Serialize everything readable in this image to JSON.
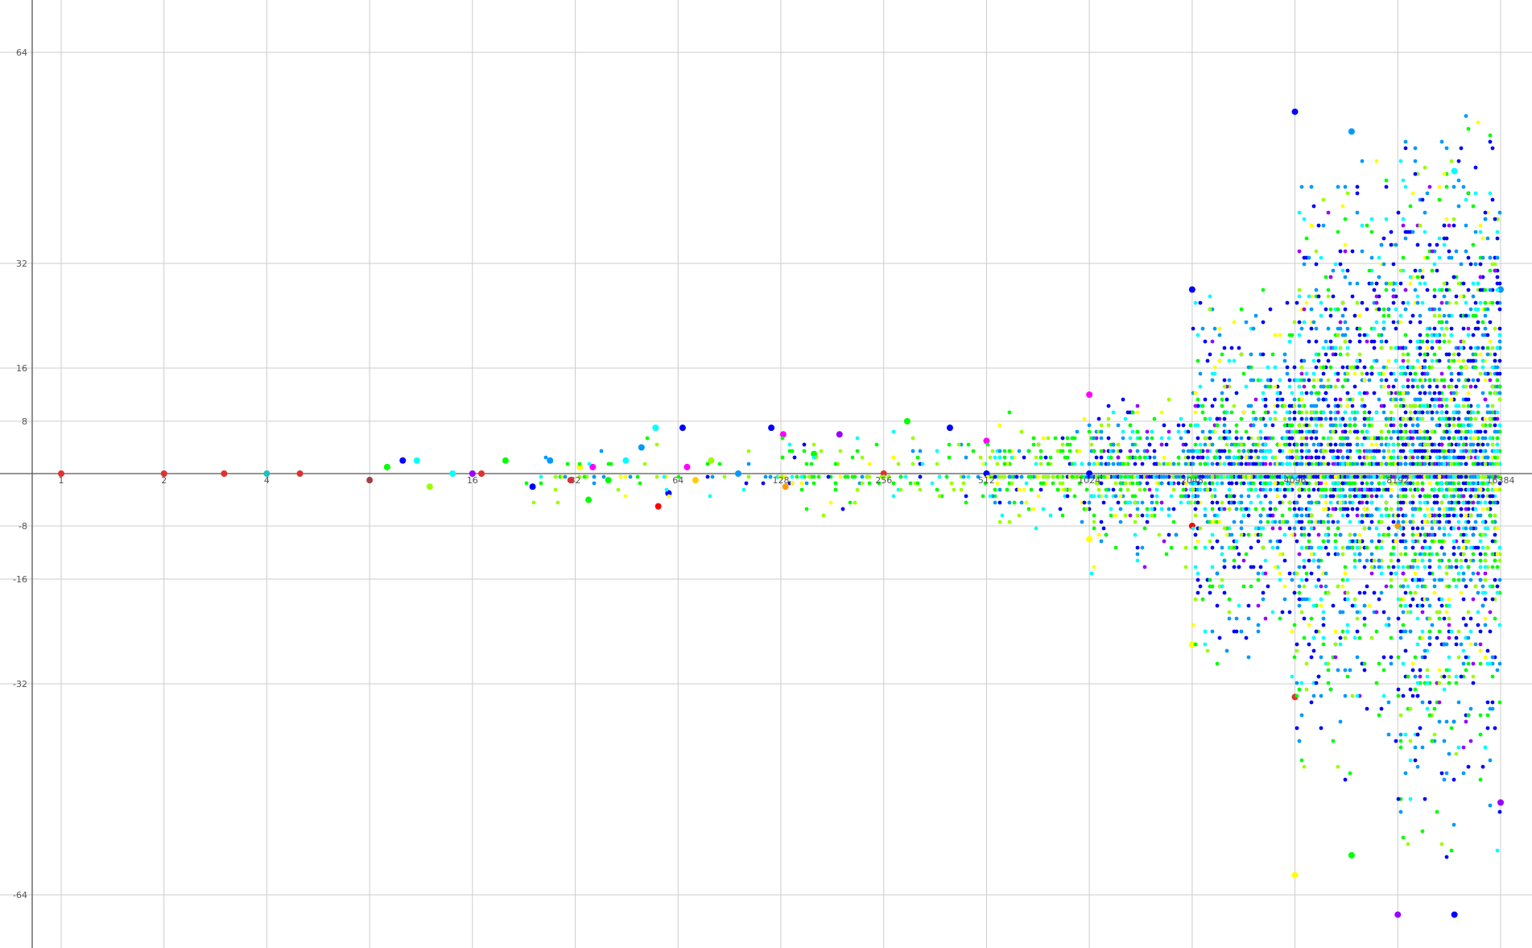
{
  "chart_data": {
    "type": "scatter",
    "title": "",
    "xlabel": "",
    "ylabel": "",
    "x_scale": "log2",
    "y_scale": "symlog2",
    "xlim": [
      0.75,
      17000
    ],
    "ylim": [
      -90,
      120
    ],
    "grid": true,
    "legend": "none",
    "x_ticks": [
      1,
      2,
      4,
      8,
      16,
      32,
      64,
      128,
      256,
      512,
      1024,
      2048,
      4096,
      8192,
      16384
    ],
    "x_tick_labels": [
      "1",
      "2",
      "4",
      "8",
      "16",
      "32",
      "64",
      "128",
      "256",
      "512",
      "1024",
      "2048",
      "4096",
      "8192",
      "16384"
    ],
    "y_ticks": [
      64,
      32,
      16,
      8,
      -8,
      -16,
      -32,
      -64
    ],
    "y_tick_labels": [
      "64",
      "32",
      "16",
      "8",
      "-8",
      "-16",
      "-32",
      "-64"
    ],
    "palette": [
      "#ff0000",
      "#ff9900",
      "#ffff00",
      "#99ff00",
      "#00ff00",
      "#00ffaa",
      "#00ffff",
      "#0099ff",
      "#0000ff",
      "#9900ff",
      "#ff00ff"
    ],
    "points": [
      {
        "x": 1,
        "y": 0,
        "c": "#e03030"
      },
      {
        "x": 2,
        "y": 0,
        "c": "#e03030"
      },
      {
        "x": 3,
        "y": 0,
        "c": "#e03030"
      },
      {
        "x": 4,
        "y": 0,
        "c": "#20c0c0"
      },
      {
        "x": 5,
        "y": 0,
        "c": "#e03030"
      },
      {
        "x": 8,
        "y": -1,
        "c": "#e03030"
      },
      {
        "x": 10,
        "y": 2,
        "c": "#0000ff"
      },
      {
        "x": 11,
        "y": 2,
        "c": "#00ffff"
      },
      {
        "x": 9,
        "y": 1,
        "c": "#00ff00"
      },
      {
        "x": 12,
        "y": -2,
        "c": "#99ff00"
      },
      {
        "x": 14,
        "y": 0,
        "c": "#00ffff"
      },
      {
        "x": 16,
        "y": 0,
        "c": "#9900ff"
      },
      {
        "x": 17,
        "y": 0,
        "c": "#e03030"
      },
      {
        "x": 20,
        "y": 2,
        "c": "#00ff00"
      },
      {
        "x": 24,
        "y": -2,
        "c": "#0000ff"
      },
      {
        "x": 27,
        "y": 2,
        "c": "#0099ff"
      },
      {
        "x": 31,
        "y": -1,
        "c": "#e03030"
      },
      {
        "x": 33,
        "y": 1,
        "c": "#ffff00"
      },
      {
        "x": 36,
        "y": 1,
        "c": "#ff00ff"
      },
      {
        "x": 35,
        "y": -4,
        "c": "#00ff00"
      },
      {
        "x": 40,
        "y": -1,
        "c": "#00ff00"
      },
      {
        "x": 45,
        "y": 2,
        "c": "#00ffff"
      },
      {
        "x": 50,
        "y": 4,
        "c": "#0099ff"
      },
      {
        "x": 55,
        "y": 7,
        "c": "#00ffff"
      },
      {
        "x": 56,
        "y": -5,
        "c": "#ff0000"
      },
      {
        "x": 60,
        "y": -3,
        "c": "#0000ff"
      },
      {
        "x": 66,
        "y": 7,
        "c": "#0000ff"
      },
      {
        "x": 68,
        "y": 1,
        "c": "#ff00ff"
      },
      {
        "x": 72,
        "y": -1,
        "c": "#ffcc00"
      },
      {
        "x": 80,
        "y": 2,
        "c": "#99ff00"
      },
      {
        "x": 96,
        "y": 0,
        "c": "#0099ff"
      },
      {
        "x": 120,
        "y": 7,
        "c": "#0000ff"
      },
      {
        "x": 130,
        "y": 6,
        "c": "#ff00ff"
      },
      {
        "x": 132,
        "y": -2,
        "c": "#ff9900"
      },
      {
        "x": 160,
        "y": 3,
        "c": "#00ff00"
      },
      {
        "x": 190,
        "y": 6,
        "c": "#9900ff"
      },
      {
        "x": 256,
        "y": 0,
        "c": "#e03030"
      },
      {
        "x": 300,
        "y": 8,
        "c": "#00ff00"
      },
      {
        "x": 400,
        "y": 7,
        "c": "#0000ff"
      },
      {
        "x": 512,
        "y": 5,
        "c": "#ff00ff"
      },
      {
        "x": 512,
        "y": 0,
        "c": "#0000ff"
      },
      {
        "x": 1024,
        "y": 12,
        "c": "#ff00ff"
      },
      {
        "x": 1024,
        "y": -10,
        "c": "#ffff00"
      },
      {
        "x": 1024,
        "y": 0,
        "c": "#0000ff"
      },
      {
        "x": 2048,
        "y": 28,
        "c": "#0000ff"
      },
      {
        "x": 2048,
        "y": -26,
        "c": "#ffff00"
      },
      {
        "x": 2048,
        "y": -8,
        "c": "#ff0000"
      },
      {
        "x": 4096,
        "y": 55,
        "c": "#0000ff"
      },
      {
        "x": 4096,
        "y": -34,
        "c": "#e03030"
      },
      {
        "x": 4096,
        "y": -61,
        "c": "#ffff00"
      },
      {
        "x": 6000,
        "y": 52,
        "c": "#0099ff"
      },
      {
        "x": 6000,
        "y": -58,
        "c": "#00ff00"
      },
      {
        "x": 8192,
        "y": -67,
        "c": "#9900ff"
      },
      {
        "x": 8192,
        "y": -8,
        "c": "#ff9900"
      },
      {
        "x": 12000,
        "y": 46,
        "c": "#00ffff"
      },
      {
        "x": 12000,
        "y": -67,
        "c": "#0000ff"
      },
      {
        "x": 16384,
        "y": 28,
        "c": "#0099ff"
      },
      {
        "x": 16384,
        "y": -50,
        "c": "#9900ff"
      }
    ]
  }
}
